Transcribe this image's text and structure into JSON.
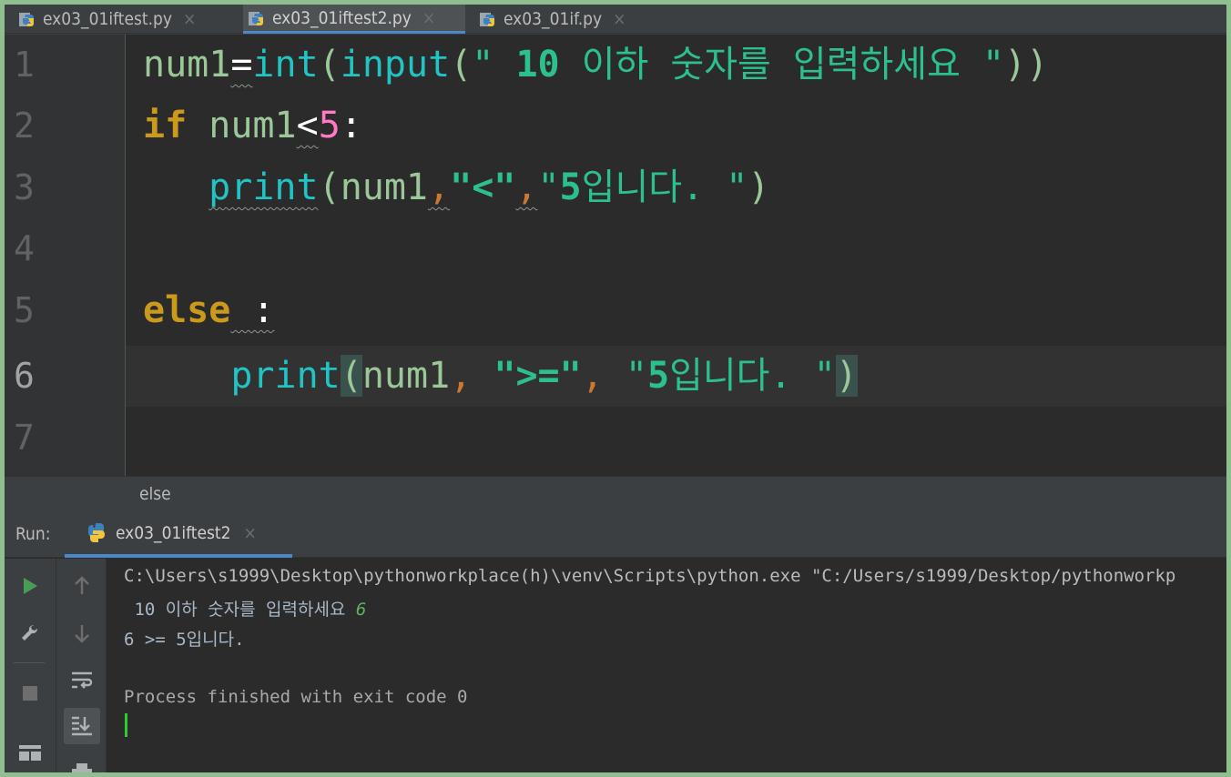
{
  "tabs": [
    {
      "label": "ex03_01iftest.py",
      "active": false,
      "close": "×",
      "icon": "python-icon"
    },
    {
      "label": "ex03_01iftest2.py",
      "active": true,
      "close": "×",
      "icon": "python-icon"
    },
    {
      "label": "ex03_01if.py",
      "active": false,
      "close": "×",
      "icon": "python-icon"
    }
  ],
  "editor": {
    "line_numbers": [
      "1",
      "2",
      "3",
      "4",
      "5",
      "6",
      "7"
    ],
    "current_line": "6",
    "lines": [
      "num1=int(input(\" 10 이하 숫자를 입력하세요 \"))",
      "if num1<5:",
      "   print(num1,\"<\",\"5입니다. \")",
      "",
      "else :",
      "    print(num1, \">=\", \"5입니다. \")",
      ""
    ],
    "tokens": {
      "l1": {
        "var": "num1",
        "op": "=",
        "fn1": "int",
        "p1": "(",
        "fn2": "input",
        "p2": "(",
        "str_open": "\" ",
        "str_num": "10",
        "str_text": " 이하 숫자를 입력하세요 \"",
        "p3": "))"
      },
      "l2": {
        "kw": "if",
        "var": "num1",
        "op": "<",
        "num": "5",
        "colon": ":"
      },
      "l3": {
        "fn": "print",
        "p1": "(",
        "var": "num1",
        "c1": ",",
        "s1": "\"<\"",
        "c2": ",",
        "s2_open": "\"",
        "s2_num": "5",
        "s2_text": "입니다. \"",
        "p2": ")"
      },
      "l5": {
        "kw": "else",
        "colon": " :"
      },
      "l6": {
        "fn": "print",
        "p1": "(",
        "var": "num1",
        "c1": ",",
        "s1": "\">=\"",
        "c2": ",",
        "s2_open": "\"",
        "s2_num": "5",
        "s2_text": "입니다. \"",
        "p2": ")"
      }
    }
  },
  "breadcrumb": "else",
  "run": {
    "label": "Run:",
    "tab_label": "ex03_01iftest2",
    "tab_close": "×",
    "console": {
      "command": "C:\\Users\\s1999\\Desktop\\pythonworkplace(h)\\venv\\Scripts\\python.exe \"C:/Users/s1999/Desktop/pythonworkp",
      "prompt": " 10 이하 숫자를 입력하세요 ",
      "input_value": "6",
      "output": "6 >= 5입니다.",
      "finished": "Process finished with exit code 0"
    }
  },
  "colors": {
    "frame_border": "#8fbf8f",
    "editor_bg": "#2b2b2b",
    "keyword": "#cc9a1b",
    "function": "#21c3c3",
    "string": "#2cc08c",
    "number": "#ff79c6",
    "run_green": "#499c54"
  }
}
